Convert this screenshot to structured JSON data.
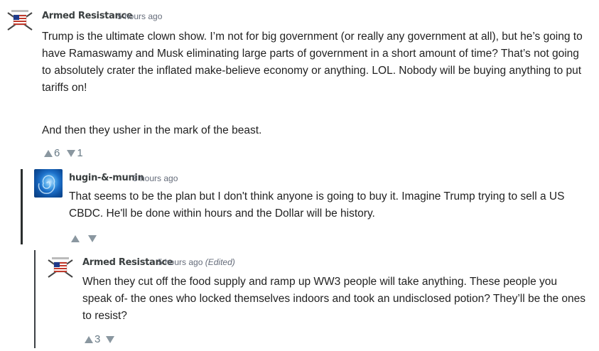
{
  "comments": [
    {
      "author": "Armed Resistance",
      "time": "5 hours ago",
      "edited": "",
      "paragraphs": [
        "Trump is the ultimate clown show.  I’m not for big government (or really any government at all), but he’s going to have Ramaswamy and Musk eliminating large parts of government in a short amount of time?  That’s not going to absolutely crater the inflated make-believe economy or anything.  LOL.  Nobody will be buying anything to put tariffs on!",
        "And then they usher in the mark of the beast."
      ],
      "upvotes": "6",
      "downvotes": "1"
    },
    {
      "author": "hugin-&-munin",
      "time": "5 hours ago",
      "edited": "",
      "paragraphs": [
        "That seems to be the plan but I don't think anyone is going to buy it. Imagine Trump trying to sell a US CBDC. He'll be done within hours and the Dollar will be history."
      ],
      "upvotes": "",
      "downvotes": ""
    },
    {
      "author": "Armed Resistance",
      "time": "5 hours ago",
      "edited": "(Edited)",
      "paragraphs": [
        "When they cut off the food supply and ramp up WW3 people will take anything.  These people you speak of- the ones who locked themselves indoors and took an undisclosed potion?  They’ll be the ones to resist?"
      ],
      "upvotes": "3",
      "downvotes": ""
    }
  ],
  "icons": {
    "avatar_armed": "american-flag-guns-avatar",
    "avatar_hugin": "blue-swirl-avatar",
    "upvote": "upvote-arrow-icon",
    "downvote": "downvote-arrow-icon"
  }
}
